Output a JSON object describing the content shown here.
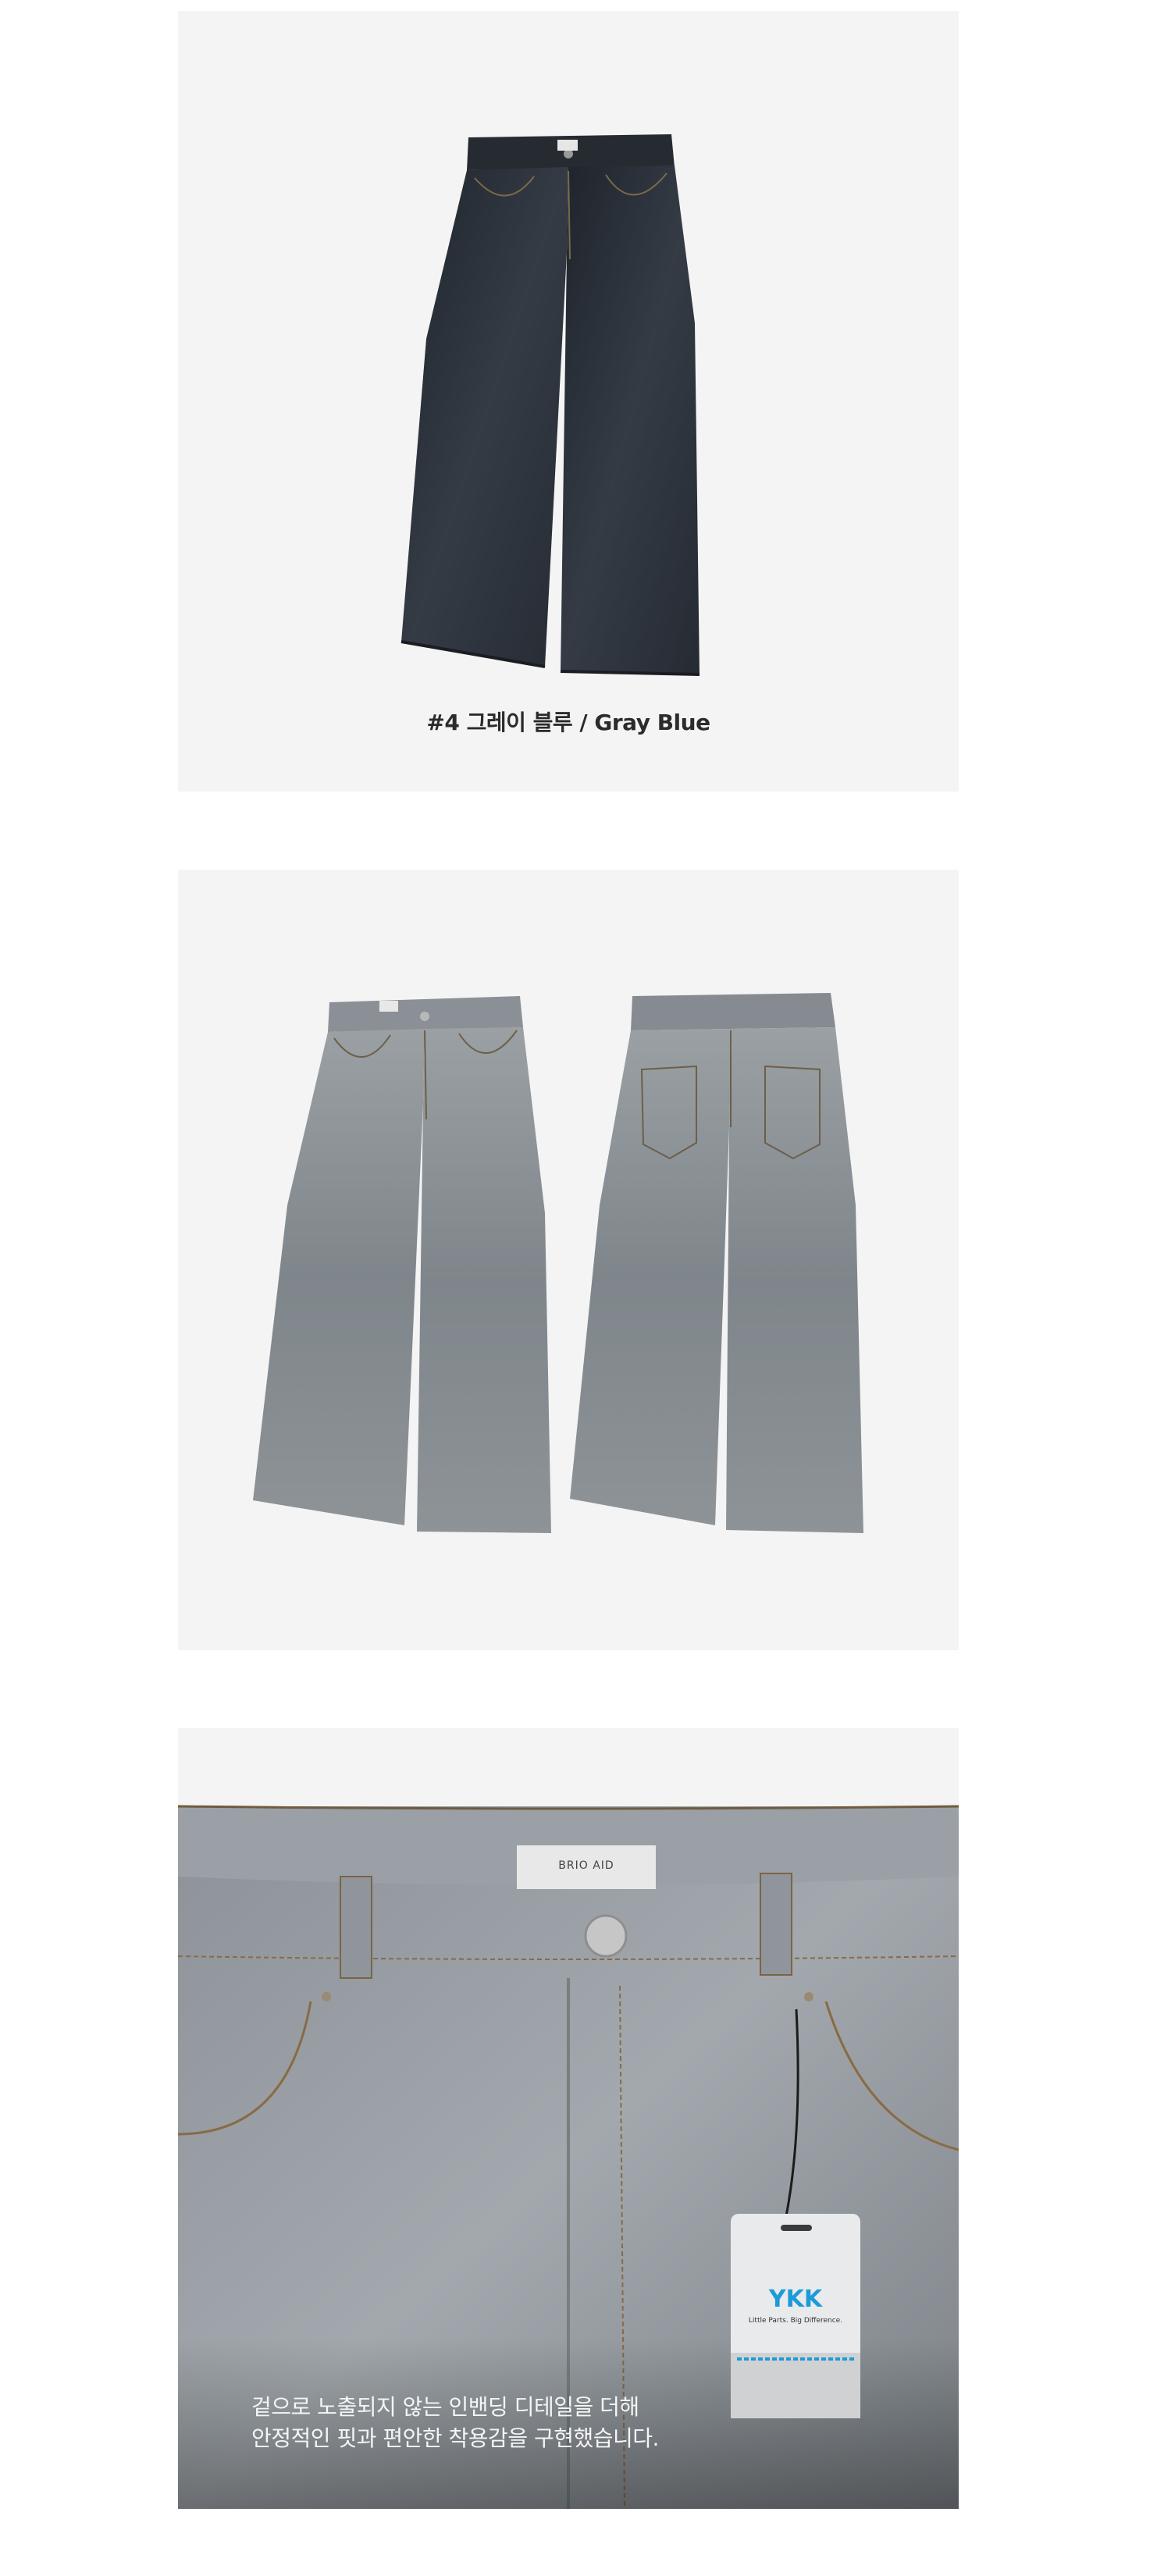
{
  "products": [
    {
      "caption": "#4 그레이 블루 / Gray Blue",
      "image": "dark-gray-blue-wide-jeans-front"
    },
    {
      "image": "light-gray-wash-jeans-front-and-back"
    },
    {
      "image": "waistband-detail-closeup",
      "label_tag": "BRIO AID",
      "hang_tag": {
        "brand": "YKK",
        "tagline": "Little Parts. Big Difference."
      },
      "overlay_lines": [
        "겉으로 노출되지 않는 인밴딩 디테일을 더해",
        "안정적인 핏과 편안한 착용감을 구현했습니다."
      ]
    }
  ],
  "colors": {
    "panel_bg": "#f4f4f4",
    "dark_denim": "#2a3038",
    "light_denim": "#8e9499",
    "ykk_blue": "#1d9bd8"
  }
}
